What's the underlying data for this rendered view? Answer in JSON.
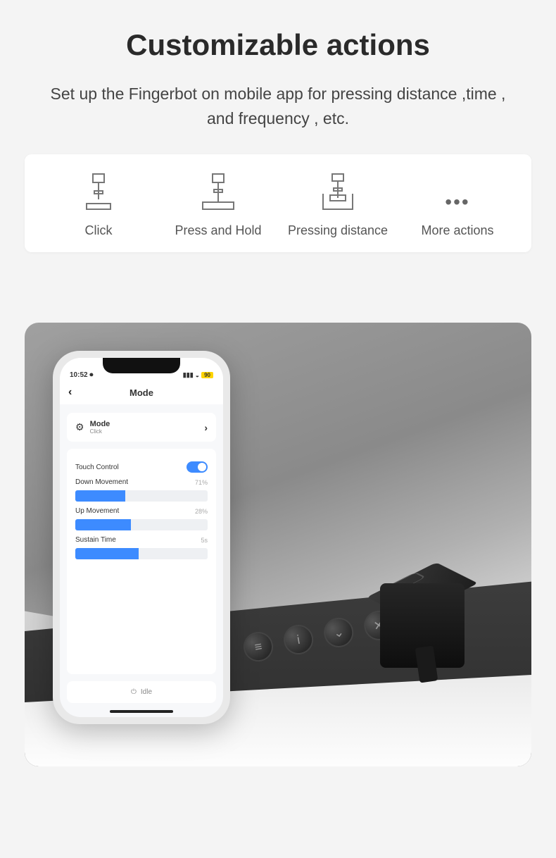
{
  "header": {
    "title": "Customizable actions",
    "subtitle": "Set up the Fingerbot on mobile app for pressing distance ,time , and frequency , etc."
  },
  "actions": {
    "click": "Click",
    "press_hold": "Press and Hold",
    "distance": "Pressing distance",
    "more": "More actions"
  },
  "phone": {
    "time": "10:52",
    "battery": "90",
    "screen_title": "Mode",
    "mode_label": "Mode",
    "mode_value": "Click",
    "touch_control": "Touch Control",
    "down_label": "Down Movement",
    "down_value": "71%",
    "down_pct": 38,
    "up_label": "Up Movement",
    "up_value": "28%",
    "up_pct": 42,
    "sustain_label": "Sustain Time",
    "sustain_value": "5s",
    "sustain_pct": 48,
    "idle": "Idle"
  }
}
